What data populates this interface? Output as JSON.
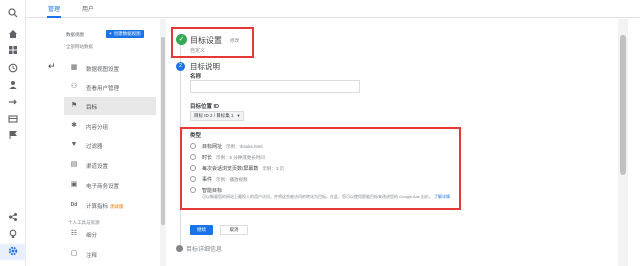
{
  "rail": {
    "icons": [
      "search-icon",
      "home-icon",
      "dashboard-icon",
      "clock-icon",
      "person-icon",
      "target-icon",
      "table-icon",
      "flag-icon",
      "share-icon",
      "bulb-icon",
      "gear-icon"
    ],
    "active": "gear-icon"
  },
  "tabs": [
    {
      "label": "管理",
      "active": true
    },
    {
      "label": "用户",
      "active": false
    }
  ],
  "column": {
    "header": "数据视图",
    "create_button": "创建数据视图",
    "subtitle": "全部网站数据",
    "items": [
      {
        "label": "数据视图设置",
        "icon": "doc-icon",
        "active": false
      },
      {
        "label": "查看用户管理",
        "icon": "users-icon",
        "active": false
      },
      {
        "label": "目标",
        "icon": "flag-icon",
        "active": true
      },
      {
        "label": "内容分组",
        "icon": "figure-icon",
        "active": false
      },
      {
        "label": "过滤器",
        "icon": "filter-icon",
        "active": false
      },
      {
        "label": "渠道设置",
        "icon": "channel-icon",
        "active": false
      },
      {
        "label": "电子商务设置",
        "icon": "cart-icon",
        "active": false
      },
      {
        "label": "计算指标",
        "icon": "dd-icon",
        "active": false,
        "badge": "测试版"
      },
      {
        "label": "细分",
        "icon": "segment-icon",
        "active": false
      },
      {
        "label": "注释",
        "icon": "note-icon",
        "active": false
      }
    ],
    "section_label": "个人工具与资源"
  },
  "goal": {
    "step1": {
      "title": "目标设置",
      "edit": "修改",
      "value": "自定义"
    },
    "step2": {
      "number": "2",
      "title": "目标说明"
    },
    "name_label": "名称",
    "name_value": "",
    "slot_label": "目标位置 ID",
    "slot_value": "目标 ID 2 / 目标集 1",
    "type_label": "类型",
    "types": [
      {
        "name": "目标网址",
        "example": "示例：thanks.html"
      },
      {
        "name": "时长",
        "example": "示例：5 分钟或更长时间"
      },
      {
        "name": "每次会话浏览页数/屏幕数",
        "example": "示例：3 页"
      },
      {
        "name": "事件",
        "example": "示例：播放视频"
      },
      {
        "name": "智能目标",
        "example": ""
      }
    ],
    "smart_desc": "可以衡量您的网站上最投入的用户访问，并将这些被访问的转化为目标。在此，您可以使用智能目标来改进您的 Google Ads 出价。",
    "smart_link": "了解详情",
    "save": "继续",
    "cancel": "取消",
    "step3": {
      "title": "目标详细信息"
    }
  },
  "highlight_color": "#e53935",
  "accent_color": "#1a73e8"
}
